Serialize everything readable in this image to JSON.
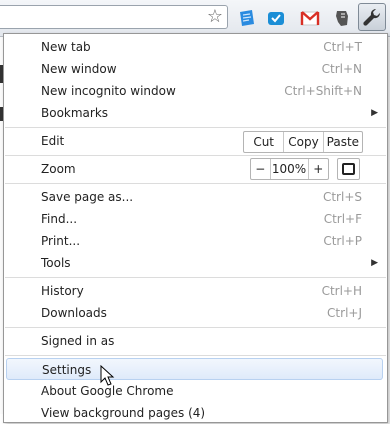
{
  "toolbar": {
    "extensions": [
      "evernote-icon",
      "delicious-icon",
      "gmail-icon",
      "evernote-clipper-icon"
    ]
  },
  "menu": {
    "new_tab": {
      "label": "New tab",
      "shortcut": "Ctrl+T"
    },
    "new_window": {
      "label": "New window",
      "shortcut": "Ctrl+N"
    },
    "new_incognito": {
      "label": "New incognito window",
      "shortcut": "Ctrl+Shift+N"
    },
    "bookmarks": {
      "label": "Bookmarks"
    },
    "edit": {
      "label": "Edit",
      "cut": "Cut",
      "copy": "Copy",
      "paste": "Paste"
    },
    "zoom": {
      "label": "Zoom",
      "minus": "−",
      "level": "100%",
      "plus": "+"
    },
    "save_page": {
      "label": "Save page as...",
      "shortcut": "Ctrl+S"
    },
    "find": {
      "label": "Find...",
      "shortcut": "Ctrl+F"
    },
    "print": {
      "label": "Print...",
      "shortcut": "Ctrl+P"
    },
    "tools": {
      "label": "Tools"
    },
    "history": {
      "label": "History",
      "shortcut": "Ctrl+H"
    },
    "downloads": {
      "label": "Downloads",
      "shortcut": "Ctrl+J"
    },
    "signed_in": {
      "label": "Signed in as"
    },
    "settings": {
      "label": "Settings"
    },
    "about": {
      "label": "About Google Chrome"
    },
    "background_pages": {
      "label": "View background pages (4)"
    }
  },
  "colors": {
    "hover_fill": "#dfeafa",
    "hover_border": "#b8d1f0",
    "shortcut_text": "#9a9a9a"
  }
}
